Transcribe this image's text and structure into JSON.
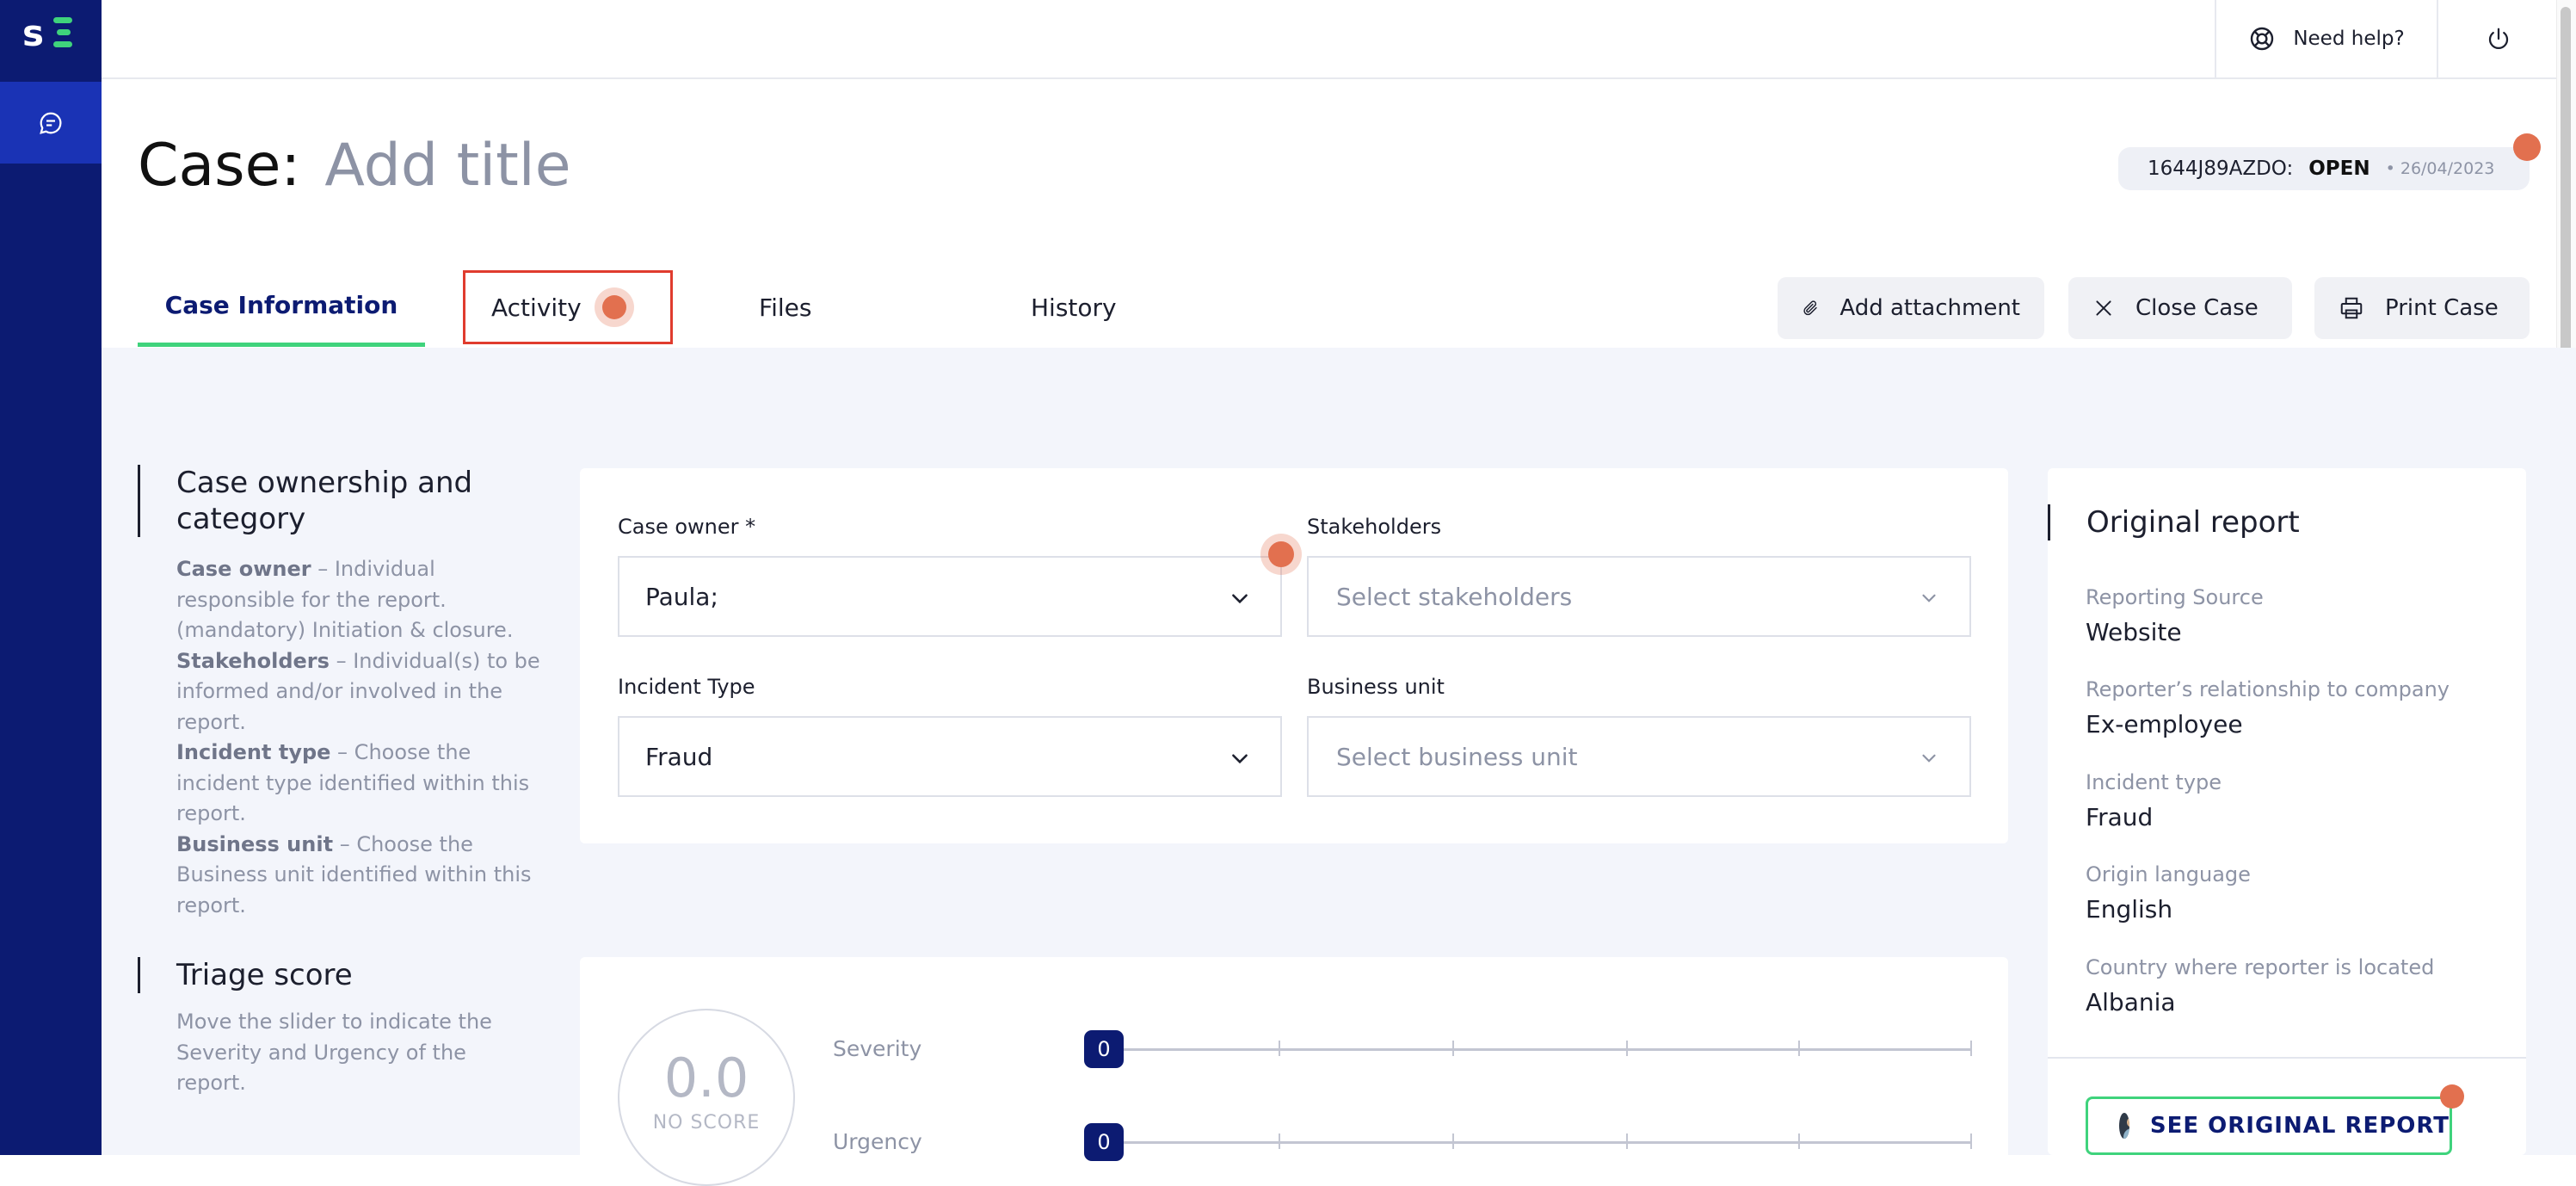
{
  "sidebar": {
    "logo_text": "s",
    "nav_items": [
      {
        "icon": "chat-bubble-icon"
      }
    ]
  },
  "topbar": {
    "help_label": "Need help?",
    "help_icon": "lifebuoy-icon",
    "power_icon": "power-icon"
  },
  "header": {
    "case_label": "Case:",
    "title_placeholder": "Add title",
    "case_id": "1644J89AZDO:",
    "status": "OPEN",
    "date": "• 26/04/2023"
  },
  "tabs": [
    {
      "label": "Case Information",
      "active": true
    },
    {
      "label": "Activity",
      "active": false
    },
    {
      "label": "Files",
      "active": false
    },
    {
      "label": "History",
      "active": false
    }
  ],
  "actions": {
    "add_attachment": "Add attachment",
    "close_case": "Close Case",
    "print_case": "Print Case"
  },
  "ownership": {
    "heading_line1": "Case ownership and",
    "heading_line2": "category",
    "desc": [
      {
        "term": "Case owner",
        "text": " – Individual responsible for the report. (mandatory) Initiation & closure."
      },
      {
        "term": "Stakeholders",
        "text": " – Individual(s) to be informed and/or involved in the report."
      },
      {
        "term": "Incident type",
        "text": " – Choose the incident type identified within this report."
      },
      {
        "term": "Business unit",
        "text": " – Choose the Business unit identified within this report."
      }
    ]
  },
  "form": {
    "case_owner_label": "Case owner *",
    "case_owner_value": "Paula;",
    "stakeholders_label": "Stakeholders",
    "stakeholders_placeholder": "Select stakeholders",
    "incident_type_label": "Incident Type",
    "incident_type_value": "Fraud",
    "business_unit_label": "Business unit",
    "business_unit_placeholder": "Select business unit"
  },
  "triage": {
    "heading": "Triage score",
    "desc": "Move the slider to indicate the Severity and Urgency of the report.",
    "score": "0.0",
    "score_label": "NO SCORE",
    "severity_label": "Severity",
    "severity_value": "0",
    "urgency_label": "Urgency",
    "urgency_value": "0"
  },
  "original_report": {
    "heading": "Original report",
    "fields": [
      {
        "label": "Reporting Source",
        "value": "Website"
      },
      {
        "label": "Reporter’s relationship to company",
        "value": "Ex-employee"
      },
      {
        "label": "Incident type",
        "value": "Fraud"
      },
      {
        "label": "Origin language",
        "value": "English"
      },
      {
        "label": "Country where reporter is located",
        "value": "Albania"
      }
    ],
    "button_label": "SEE ORIGINAL REPORT"
  },
  "colors": {
    "sidebar": "#0c1b72",
    "accent_green": "#3fd37c",
    "hotspot": "#e2704f",
    "highlight_border": "#e03c2e"
  }
}
